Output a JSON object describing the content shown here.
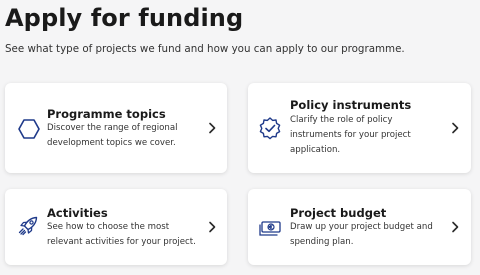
{
  "header": {
    "title": "Apply for funding",
    "subtitle": "See what type of projects we fund and how you can apply to our programme."
  },
  "cards": [
    {
      "title": "Programme topics",
      "desc_lines": [
        "Discover the range of regional",
        "development topics we cover."
      ],
      "icon": "hexagon-icon"
    },
    {
      "title": "Policy instruments",
      "desc_lines": [
        "Clarify the role of policy",
        "instruments for your project",
        "application."
      ],
      "icon": "badge-check-icon"
    },
    {
      "title": "Activities",
      "desc_lines": [
        "See how to choose the most",
        "relevant activities for your project."
      ],
      "icon": "rocket-icon"
    },
    {
      "title": "Project budget",
      "desc_lines": [
        "Draw up your project budget and",
        "spending plan."
      ],
      "icon": "euro-money-icon"
    }
  ],
  "colors": {
    "accent": "#1f3a8a",
    "background": "#f5f5f6",
    "card": "#ffffff"
  }
}
